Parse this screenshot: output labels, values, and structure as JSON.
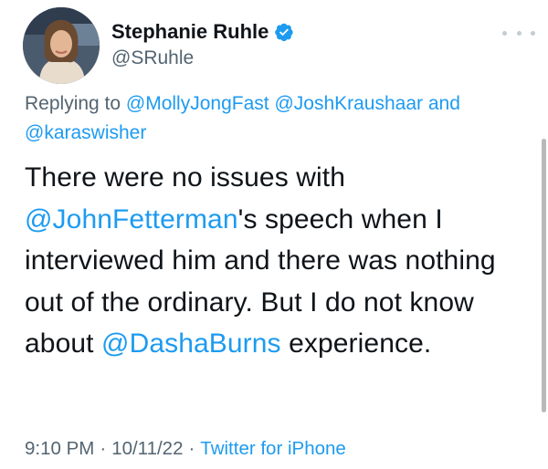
{
  "author": {
    "display_name": "Stephanie Ruhle",
    "handle": "@SRuhle",
    "verified": true,
    "avatar_icon": "profile-photo"
  },
  "reply": {
    "prefix": "Replying to ",
    "mentions": [
      "@MollyJongFast",
      "@JoshKraushaar",
      "@karaswisher"
    ],
    "conjunction": " and "
  },
  "tweet": {
    "segments": [
      {
        "text": "There were no issues with ",
        "type": "text"
      },
      {
        "text": "@JohnFetterman",
        "type": "mention"
      },
      {
        "text": "'s speech when I interviewed him and there was nothing out of the ordinary. But I do not know about ",
        "type": "text"
      },
      {
        "text": "@DashaBurns",
        "type": "mention"
      },
      {
        "text": " experience.",
        "type": "text"
      }
    ]
  },
  "meta": {
    "time": "9:10 PM",
    "separator": "·",
    "date": "10/11/22",
    "source": "Twitter for iPhone"
  },
  "colors": {
    "link": "#1d9bf0",
    "text": "#0f1419",
    "muted": "#536471",
    "verified": "#1d9bf0"
  }
}
